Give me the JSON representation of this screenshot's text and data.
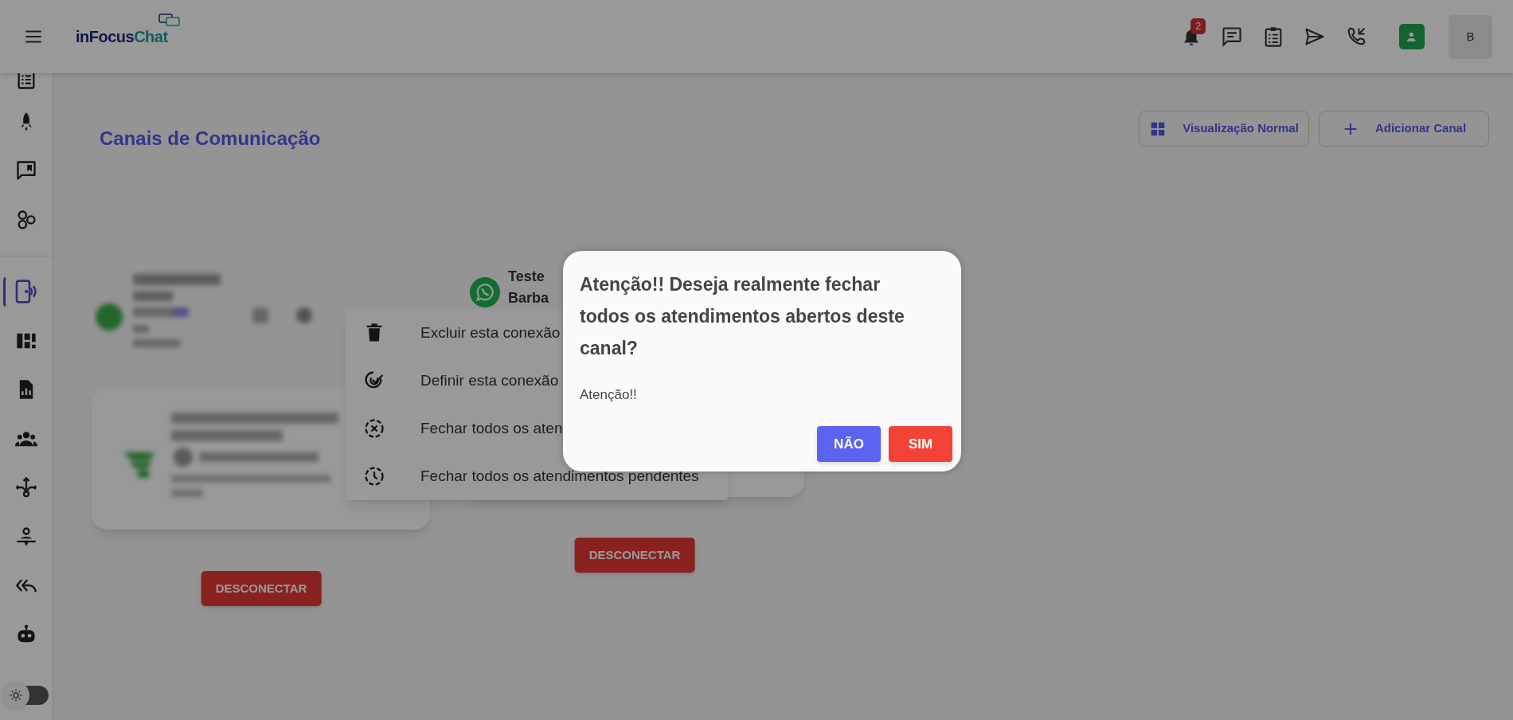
{
  "topbar": {
    "logo": {
      "primary": "inFocus",
      "accent": "Chat"
    },
    "notifications": "2",
    "user_initial": "B"
  },
  "sidebar": {
    "groups": [
      {
        "items": [
          {
            "kind": "list",
            "selected": false
          },
          {
            "kind": "rocket",
            "selected": false
          },
          {
            "kind": "chat",
            "selected": false
          },
          {
            "kind": "hex",
            "selected": false
          }
        ]
      },
      {
        "items": [
          {
            "kind": "phone",
            "selected": true
          },
          {
            "kind": "dashboard",
            "selected": false
          },
          {
            "kind": "report",
            "selected": false
          },
          {
            "kind": "group",
            "selected": false
          },
          {
            "kind": "split",
            "selected": false
          },
          {
            "kind": "person",
            "selected": false
          },
          {
            "kind": "replyall",
            "selected": false
          },
          {
            "kind": "robot",
            "selected": false
          }
        ]
      }
    ],
    "theme_toggle": {
      "on": false
    }
  },
  "page": {
    "title": "Canais de Comunicação",
    "buttons": [
      {
        "kind": "grid",
        "label": "Visualização Normal"
      },
      {
        "kind": "add",
        "label": "Adicionar Canal"
      }
    ]
  },
  "channels": [
    {
      "kind": "blurred",
      "button": "DESCONECTAR"
    },
    {
      "kind": "whatsapp",
      "name_lines": [
        "Teste",
        "Barba"
      ],
      "button": "DESCONECTAR"
    }
  ],
  "context_menu": {
    "items": [
      {
        "kind": "delete",
        "label": "Excluir esta conexão"
      },
      {
        "kind": "default",
        "label": "Definir esta conexão"
      },
      {
        "kind": "close",
        "label": "Fechar todos os aten"
      },
      {
        "kind": "clock",
        "label": "Fechar todos os atendimentos pendentes"
      }
    ]
  },
  "dialog": {
    "title": "Atenção!! Deseja realmente fechar todos os atendimentos abertos deste canal?",
    "message": "Atenção!!",
    "buttons": [
      {
        "kind": "no",
        "label": "NÃO"
      },
      {
        "kind": "yes",
        "label": "SIM"
      }
    ]
  }
}
